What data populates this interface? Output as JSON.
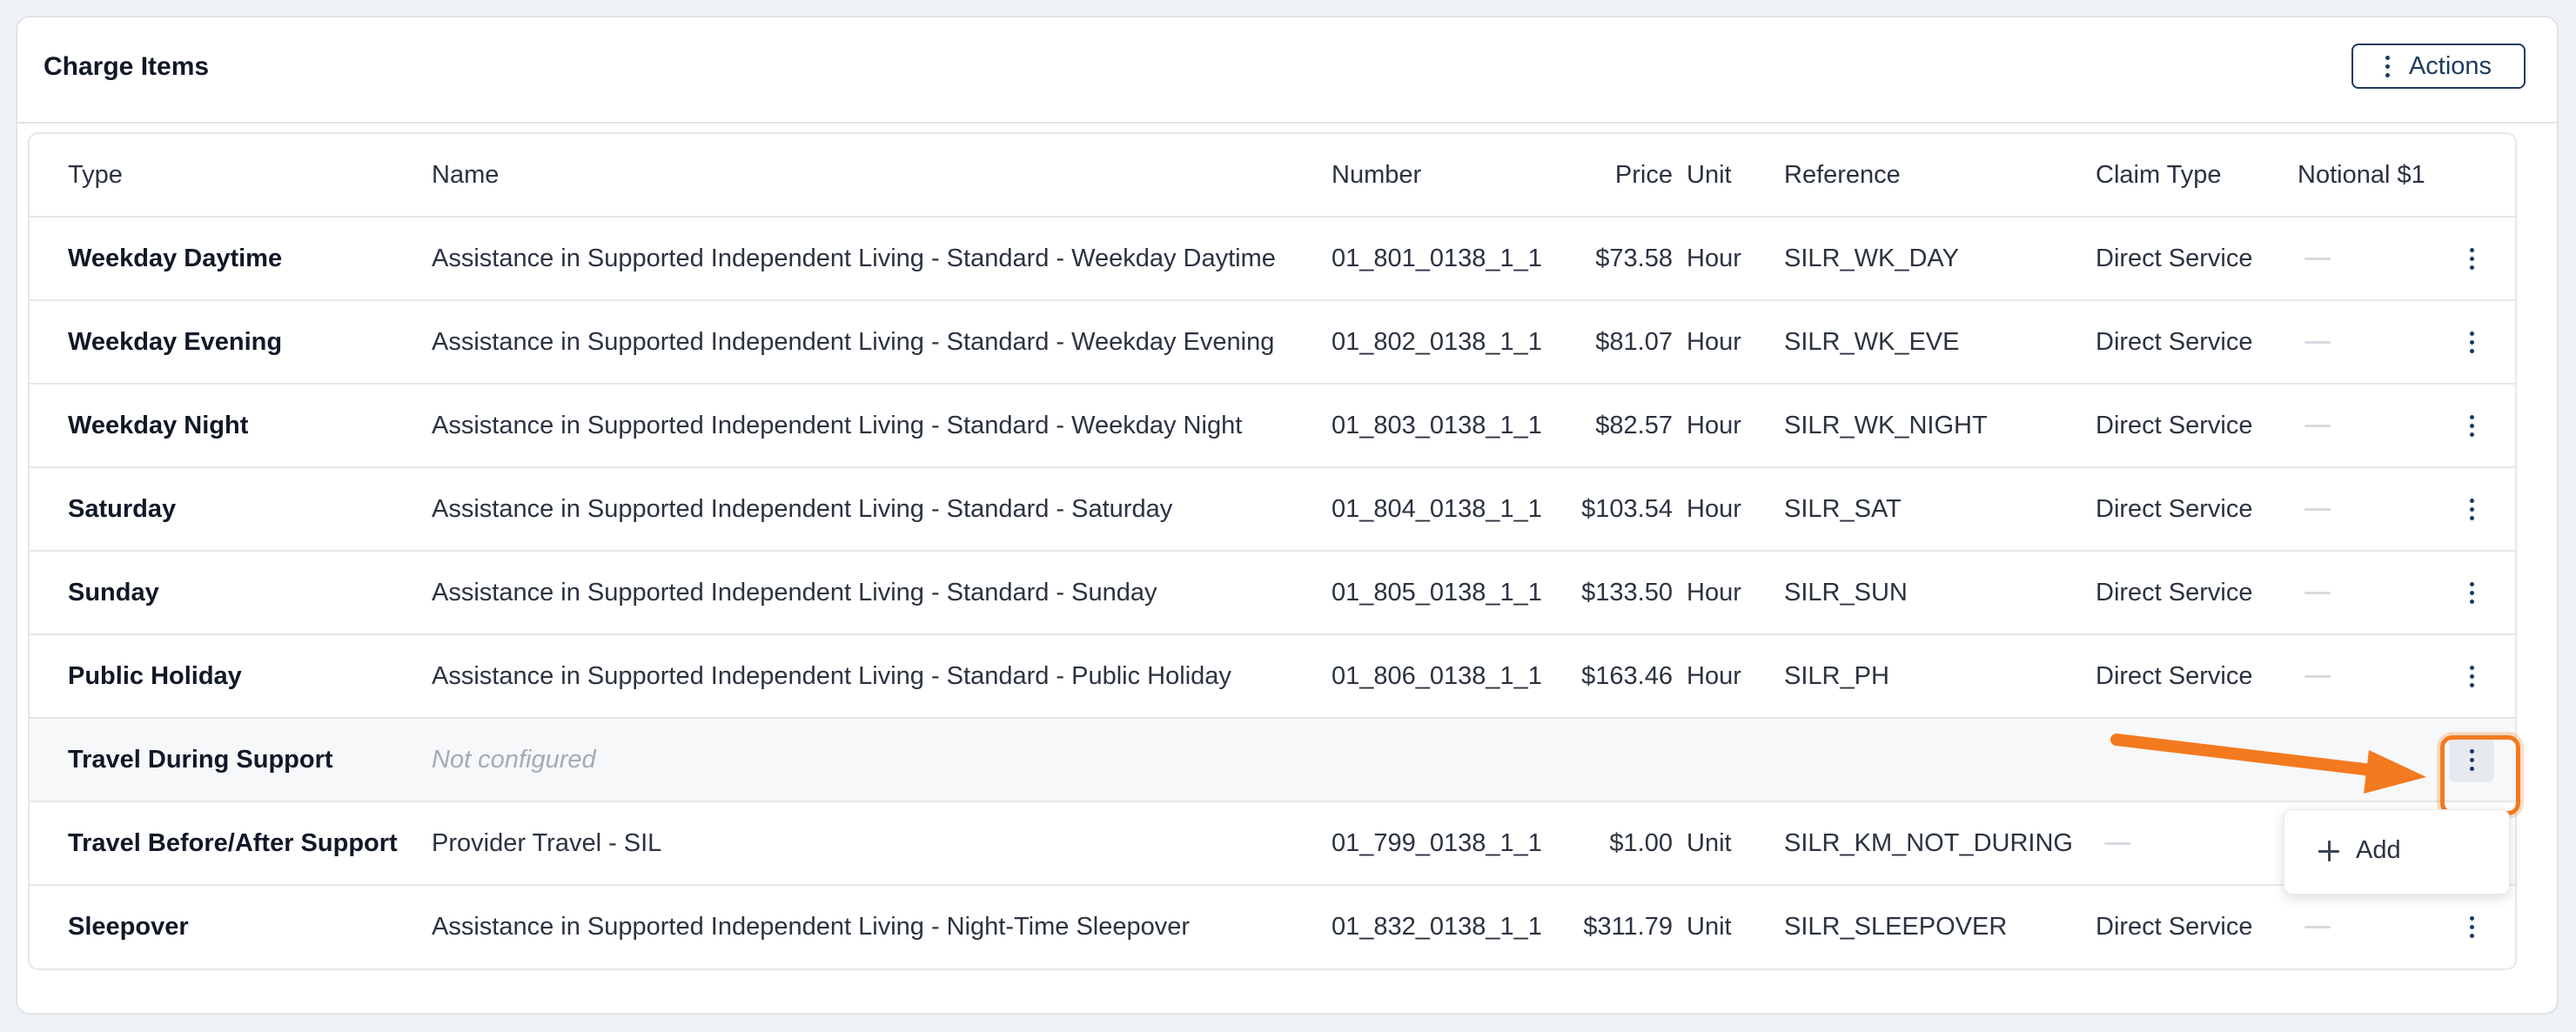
{
  "card": {
    "title": "Charge Items"
  },
  "actions": {
    "label": "Actions"
  },
  "table": {
    "columns": [
      "Type",
      "Name",
      "Number",
      "Price",
      "Unit",
      "Reference",
      "Claim Type",
      "Notional $1"
    ],
    "rows": [
      {
        "type": "Weekday Daytime",
        "name": "Assistance in Supported Independent Living - Standard - Weekday Daytime",
        "number": "01_801_0138_1_1",
        "price": "$73.58",
        "unit": "Hour",
        "reference": "SILR_WK_DAY",
        "claim_type": "Direct Service"
      },
      {
        "type": "Weekday Evening",
        "name": "Assistance in Supported Independent Living - Standard - Weekday Evening",
        "number": "01_802_0138_1_1",
        "price": "$81.07",
        "unit": "Hour",
        "reference": "SILR_WK_EVE",
        "claim_type": "Direct Service"
      },
      {
        "type": "Weekday Night",
        "name": "Assistance in Supported Independent Living - Standard - Weekday Night",
        "number": "01_803_0138_1_1",
        "price": "$82.57",
        "unit": "Hour",
        "reference": "SILR_WK_NIGHT",
        "claim_type": "Direct Service"
      },
      {
        "type": "Saturday",
        "name": "Assistance in Supported Independent Living - Standard - Saturday",
        "number": "01_804_0138_1_1",
        "price": "$103.54",
        "unit": "Hour",
        "reference": "SILR_SAT",
        "claim_type": "Direct Service"
      },
      {
        "type": "Sunday",
        "name": "Assistance in Supported Independent Living - Standard - Sunday",
        "number": "01_805_0138_1_1",
        "price": "$133.50",
        "unit": "Hour",
        "reference": "SILR_SUN",
        "claim_type": "Direct Service"
      },
      {
        "type": "Public Holiday",
        "name": "Assistance in Supported Independent Living - Standard - Public Holiday",
        "number": "01_806_0138_1_1",
        "price": "$163.46",
        "unit": "Hour",
        "reference": "SILR_PH",
        "claim_type": "Direct Service"
      },
      {
        "type": "Travel During Support",
        "name": "Not configured",
        "number": "",
        "price": "",
        "unit": "",
        "reference": "",
        "claim_type": ""
      },
      {
        "type": "Travel Before/After Support",
        "name": "Provider Travel - SIL",
        "number": "01_799_0138_1_1",
        "price": "$1.00",
        "unit": "Unit",
        "reference": "SILR_KM_NOT_DURING",
        "claim_type": ""
      },
      {
        "type": "Sleepover",
        "name": "Assistance in Supported Independent Living - Night-Time Sleepover",
        "number": "01_832_0138_1_1",
        "price": "$311.79",
        "unit": "Unit",
        "reference": "SILR_SLEEPOVER",
        "claim_type": "Direct Service"
      }
    ]
  },
  "dropdown": {
    "items": [
      {
        "label": "Add",
        "icon": "plus-icon"
      }
    ]
  },
  "colors": {
    "accent": "#f47a1f",
    "primary": "#1e3a5f"
  }
}
